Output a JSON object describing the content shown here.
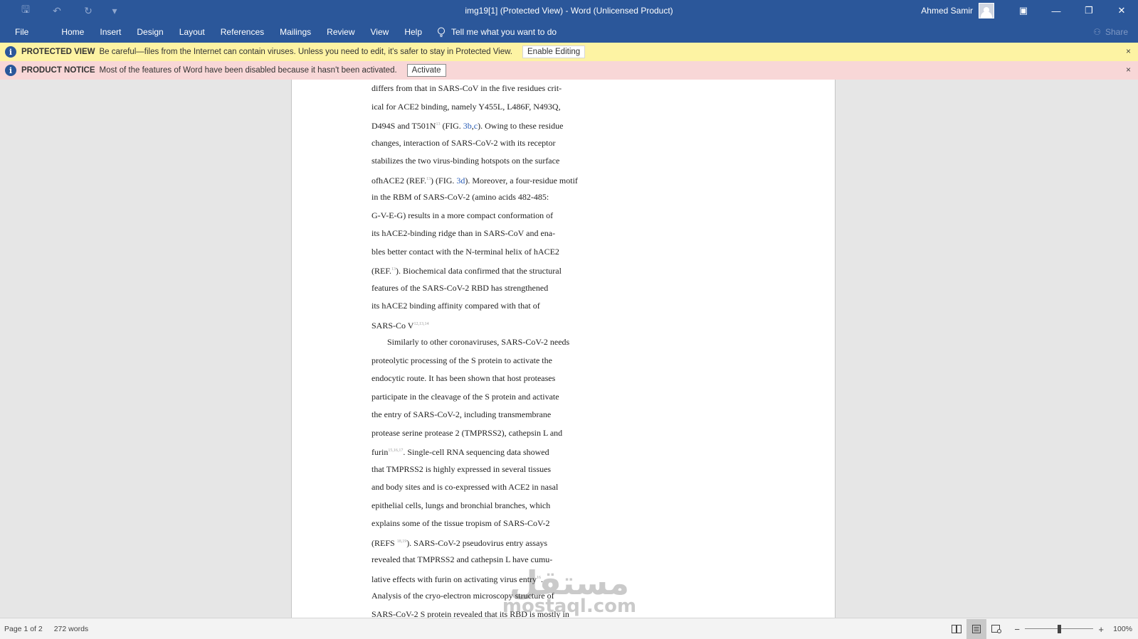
{
  "titlebar": {
    "title": "img19[1] (Protected View)  -  Word (Unlicensed Product)",
    "user_name": "Ahmed Samir",
    "qat": [
      {
        "name": "save-icon",
        "glyph": "🖫"
      },
      {
        "name": "undo-icon",
        "glyph": "↶"
      },
      {
        "name": "redo-icon",
        "glyph": "↻"
      },
      {
        "name": "customize-qat-icon",
        "glyph": "▾"
      }
    ],
    "window_buttons": {
      "ribbon_display": "▣",
      "minimize": "—",
      "restore": "❐",
      "close": "✕"
    }
  },
  "ribbon": {
    "tabs": [
      "File",
      "Home",
      "Insert",
      "Design",
      "Layout",
      "References",
      "Mailings",
      "Review",
      "View",
      "Help"
    ],
    "tell_me": "Tell me what you want to do",
    "share": "Share"
  },
  "protected_bar": {
    "title": "PROTECTED VIEW",
    "message": "Be careful—files from the Internet can contain viruses. Unless you need to edit, it's safer to stay in Protected View.",
    "button": "Enable Editing",
    "close": "×"
  },
  "notice_bar": {
    "title": "PRODUCT NOTICE",
    "message": "Most of the features of Word have been disabled because it hasn't been activated.",
    "button": "Activate",
    "close": "×"
  },
  "document": {
    "lines": [
      {
        "segments": [
          {
            "t": "differs from that in SARS-CoV in the five residues crit-"
          }
        ]
      },
      {
        "segments": [
          {
            "t": "ical for ACE2 binding, namely Y455L, L486F, N493Q,"
          }
        ]
      },
      {
        "segments": [
          {
            "t": "D494S and T501N"
          },
          {
            "t": "13",
            "style": "sup"
          },
          {
            "t": " (FIG. "
          },
          {
            "t": "3b",
            "style": "ref"
          },
          {
            "t": ","
          },
          {
            "t": "c",
            "style": "ref"
          },
          {
            "t": "). Owing to these residue"
          }
        ]
      },
      {
        "segments": [
          {
            "t": "changes, interaction of SARS-CoV-2 with its receptor"
          }
        ]
      },
      {
        "segments": [
          {
            "t": "stabilizes the two virus-binding hotspots on the surface"
          }
        ]
      },
      {
        "segments": [
          {
            "t": "ofhACE2 (REF."
          },
          {
            "t": "13",
            "style": "sup"
          },
          {
            "t": ") (FIG. "
          },
          {
            "t": "3d",
            "style": "ref"
          },
          {
            "t": "). Moreover, a four-residue motif"
          }
        ]
      },
      {
        "segments": [
          {
            "t": "in the RBM of SARS-CoV-2 (amino acids 482-485:"
          }
        ]
      },
      {
        "segments": [
          {
            "t": "G-V-E-G) results in a more compact conformation of"
          }
        ]
      },
      {
        "segments": [
          {
            "t": "its hACE2-binding ridge than in SARS-CoV and ena-"
          }
        ]
      },
      {
        "segments": [
          {
            "t": "bles better contact with the N-terminal helix of hACE2"
          }
        ]
      },
      {
        "segments": [
          {
            "t": "(REF."
          },
          {
            "t": "13",
            "style": "sup"
          },
          {
            "t": "). Biochemical data confirmed that the structural"
          }
        ]
      },
      {
        "segments": [
          {
            "t": "features of the SARS-CoV-2 RBD has strengthened"
          }
        ]
      },
      {
        "segments": [
          {
            "t": "its hACE2 binding affinity compared with that of"
          }
        ]
      },
      {
        "segments": [
          {
            "t": "SARS-Co V"
          },
          {
            "t": "12,13,14",
            "style": "sup"
          }
        ]
      },
      {
        "indent": true,
        "segments": [
          {
            "t": "Similarly to other coronaviruses, SARS-CoV-2 needs"
          }
        ]
      },
      {
        "segments": [
          {
            "t": "proteolytic processing of the S protein to activate the"
          }
        ]
      },
      {
        "segments": [
          {
            "t": "endocytic route. It has been shown that host proteases"
          }
        ]
      },
      {
        "segments": [
          {
            "t": "participate in the cleavage of the S protein and activate"
          }
        ]
      },
      {
        "segments": [
          {
            "t": "the entry of SARS-CoV-2, including transmembrane"
          }
        ]
      },
      {
        "segments": [
          {
            "t": "protease serine protease 2 (TMPRSS2), cathepsin L and"
          }
        ]
      },
      {
        "segments": [
          {
            "t": "furin"
          },
          {
            "t": "15,16,17",
            "style": "sup"
          },
          {
            "t": ". Single-cell RNA sequencing data showed"
          }
        ]
      },
      {
        "segments": [
          {
            "t": "that TMPRSS2 is highly expressed in several tissues"
          }
        ]
      },
      {
        "segments": [
          {
            "t": "and body sites and is co-expressed with ACE2 in nasal"
          }
        ]
      },
      {
        "segments": [
          {
            "t": "epithelial cells, lungs and bronchial branches, which"
          }
        ]
      },
      {
        "segments": [
          {
            "t": "explains some of the tissue tropism of SARS-CoV-2"
          }
        ]
      },
      {
        "segments": [
          {
            "t": "(REFS "
          },
          {
            "t": "18,19",
            "style": "sup"
          },
          {
            "t": "). SARS-CoV-2 pseudovirus entry assays"
          }
        ]
      },
      {
        "segments": [
          {
            "t": "revealed that TMPRSS2 and cathepsin L have cumu-"
          }
        ]
      },
      {
        "segments": [
          {
            "t": "lative effects with furin on activating virus entry"
          },
          {
            "t": "16",
            "style": "sup"
          },
          {
            "t": "."
          }
        ]
      },
      {
        "segments": [
          {
            "t": "Analysis of the cryo-electron microscopy structure of"
          }
        ]
      },
      {
        "segments": [
          {
            "t": "SARS-CoV-2 S protein revealed that its RBD is mostly in"
          }
        ]
      }
    ]
  },
  "watermark": {
    "arabic": "مستقل",
    "latin": "mostaql.com"
  },
  "statusbar": {
    "page": "Page 1 of 2",
    "words": "272 words",
    "zoom": "100%",
    "zoom_minus": "−",
    "zoom_plus": "+",
    "zoom_level": 0.5
  }
}
